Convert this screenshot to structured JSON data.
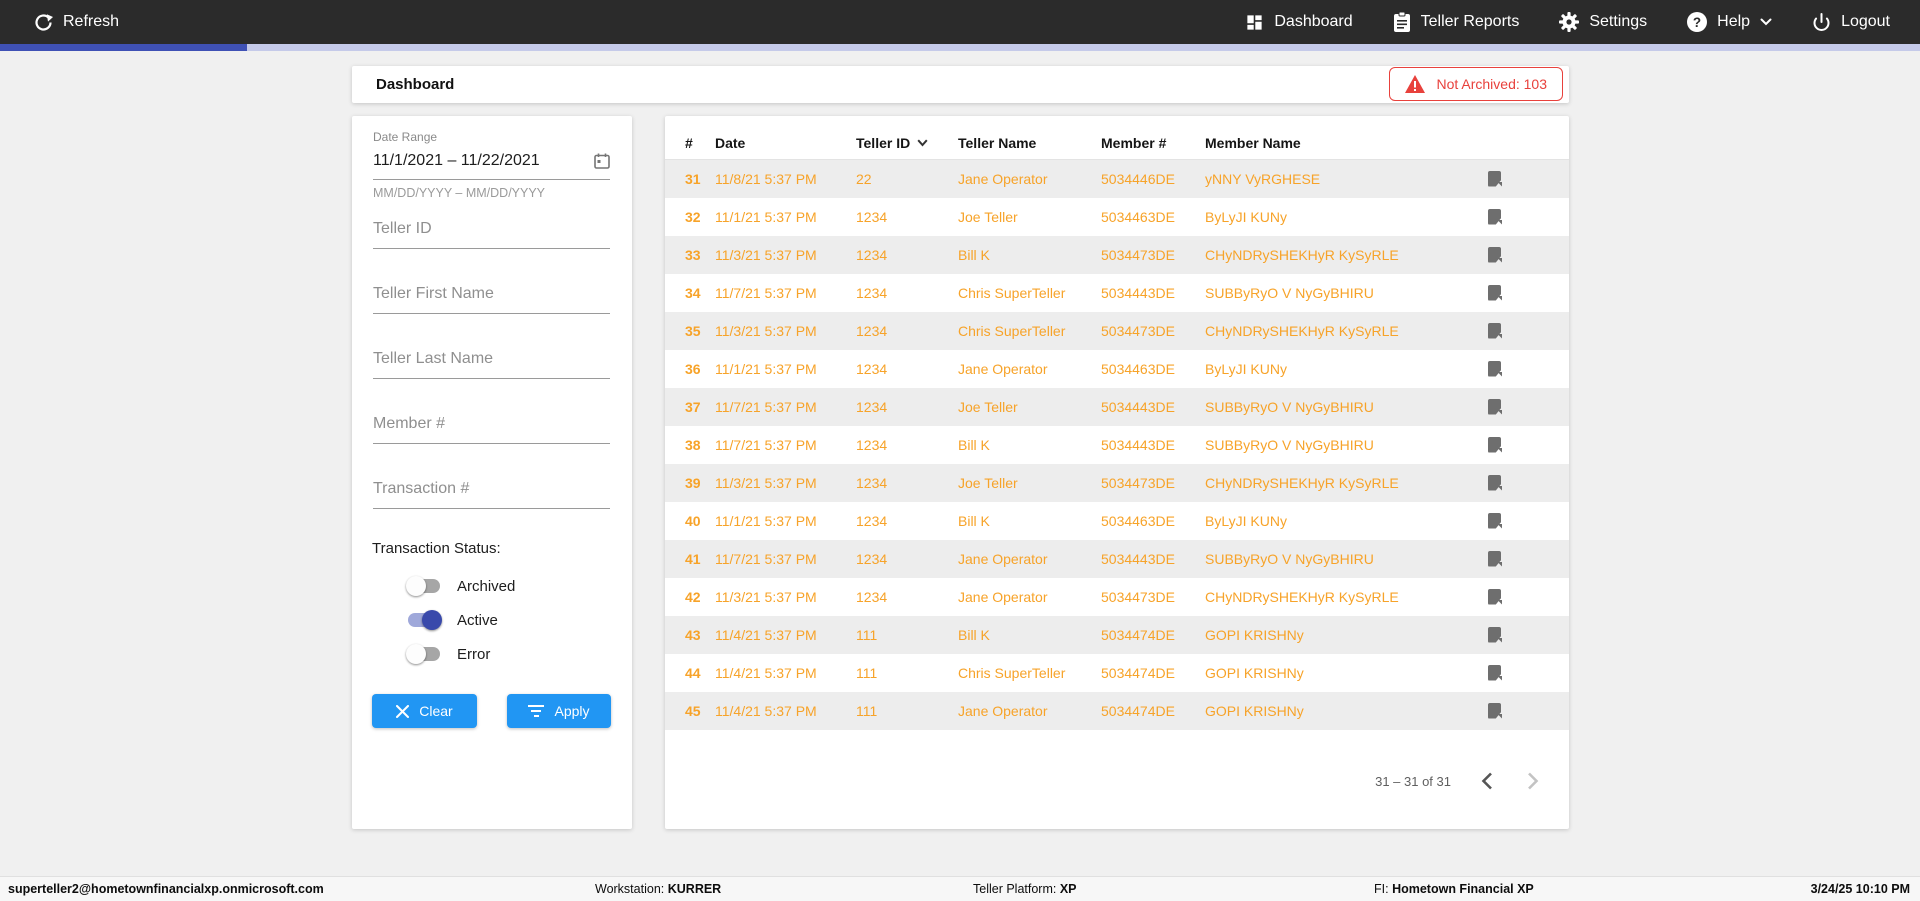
{
  "topnav": {
    "refresh_label": "Refresh",
    "dashboard_label": "Dashboard",
    "teller_reports_label": "Teller Reports",
    "settings_label": "Settings",
    "help_label": "Help",
    "logout_label": "Logout"
  },
  "header": {
    "title": "Dashboard",
    "not_archived_label": "Not Archived: 103"
  },
  "filters": {
    "date_range": {
      "label": "Date Range",
      "value": "11/1/2021 – 11/22/2021",
      "hint": "MM/DD/YYYY – MM/DD/YYYY"
    },
    "fields": [
      {
        "placeholder": "Teller ID"
      },
      {
        "placeholder": "Teller First Name"
      },
      {
        "placeholder": "Teller Last Name"
      },
      {
        "placeholder": "Member #"
      },
      {
        "placeholder": "Transaction #"
      }
    ],
    "status": {
      "label": "Transaction Status:",
      "toggles": [
        {
          "label": "Archived",
          "on": false
        },
        {
          "label": "Active",
          "on": true
        },
        {
          "label": "Error",
          "on": false
        }
      ]
    },
    "clear_label": "Clear",
    "apply_label": "Apply"
  },
  "table": {
    "columns": [
      "#",
      "Date",
      "Teller ID",
      "Teller Name",
      "Member #",
      "Member Name"
    ],
    "sorted_column": "Teller ID",
    "sort_direction": "desc",
    "rows": [
      {
        "num": "31",
        "date": "11/8/21 5:37 PM",
        "teller_id": "22",
        "teller_name": "Jane Operator",
        "member_num": "5034446DE",
        "member_name": "yNNY VyRGHESE"
      },
      {
        "num": "32",
        "date": "11/1/21 5:37 PM",
        "teller_id": "1234",
        "teller_name": "Joe Teller",
        "member_num": "5034463DE",
        "member_name": "ByLyJI KUNy"
      },
      {
        "num": "33",
        "date": "11/3/21 5:37 PM",
        "teller_id": "1234",
        "teller_name": "Bill K",
        "member_num": "5034473DE",
        "member_name": "CHyNDRySHEKHyR KySyRLE"
      },
      {
        "num": "34",
        "date": "11/7/21 5:37 PM",
        "teller_id": "1234",
        "teller_name": "Chris SuperTeller",
        "member_num": "5034443DE",
        "member_name": "SUBByRyO V NyGyBHIRU"
      },
      {
        "num": "35",
        "date": "11/3/21 5:37 PM",
        "teller_id": "1234",
        "teller_name": "Chris SuperTeller",
        "member_num": "5034473DE",
        "member_name": "CHyNDRySHEKHyR KySyRLE"
      },
      {
        "num": "36",
        "date": "11/1/21 5:37 PM",
        "teller_id": "1234",
        "teller_name": "Jane Operator",
        "member_num": "5034463DE",
        "member_name": "ByLyJI KUNy"
      },
      {
        "num": "37",
        "date": "11/7/21 5:37 PM",
        "teller_id": "1234",
        "teller_name": "Joe Teller",
        "member_num": "5034443DE",
        "member_name": "SUBByRyO V NyGyBHIRU"
      },
      {
        "num": "38",
        "date": "11/7/21 5:37 PM",
        "teller_id": "1234",
        "teller_name": "Bill K",
        "member_num": "5034443DE",
        "member_name": "SUBByRyO V NyGyBHIRU"
      },
      {
        "num": "39",
        "date": "11/3/21 5:37 PM",
        "teller_id": "1234",
        "teller_name": "Joe Teller",
        "member_num": "5034473DE",
        "member_name": "CHyNDRySHEKHyR KySyRLE"
      },
      {
        "num": "40",
        "date": "11/1/21 5:37 PM",
        "teller_id": "1234",
        "teller_name": "Bill K",
        "member_num": "5034463DE",
        "member_name": "ByLyJI KUNy"
      },
      {
        "num": "41",
        "date": "11/7/21 5:37 PM",
        "teller_id": "1234",
        "teller_name": "Jane Operator",
        "member_num": "5034443DE",
        "member_name": "SUBByRyO V NyGyBHIRU"
      },
      {
        "num": "42",
        "date": "11/3/21 5:37 PM",
        "teller_id": "1234",
        "teller_name": "Jane Operator",
        "member_num": "5034473DE",
        "member_name": "CHyNDRySHEKHyR KySyRLE"
      },
      {
        "num": "43",
        "date": "11/4/21 5:37 PM",
        "teller_id": "111",
        "teller_name": "Bill K",
        "member_num": "5034474DE",
        "member_name": "GOPI KRISHNy"
      },
      {
        "num": "44",
        "date": "11/4/21 5:37 PM",
        "teller_id": "111",
        "teller_name": "Chris SuperTeller",
        "member_num": "5034474DE",
        "member_name": "GOPI KRISHNy"
      },
      {
        "num": "45",
        "date": "11/4/21 5:37 PM",
        "teller_id": "111",
        "teller_name": "Jane Operator",
        "member_num": "5034474DE",
        "member_name": "GOPI KRISHNy"
      }
    ],
    "pagination": {
      "range_label": "31 – 31 of 31",
      "prev_enabled": true,
      "next_enabled": false
    }
  },
  "statusbar": {
    "user": "superteller2@hometownfinancialxp.onmicrosoft.com",
    "workstation_label": "Workstation:",
    "workstation": "KURRER",
    "platform_label": "Teller Platform:",
    "platform": "XP",
    "fi_label": "FI:",
    "fi": "Hometown Financial XP",
    "datetime": "3/24/25 10:10 PM"
  },
  "icons": {
    "refresh-icon": "circular-arrow",
    "dashboard-icon": "grid-tiles",
    "clipboard-icon": "clipboard",
    "gear-icon": "cog",
    "help-icon": "question-circle",
    "chevron-down-icon": "chevron-down",
    "power-icon": "power",
    "warning-icon": "warning-triangle",
    "calendar-icon": "calendar",
    "clear-x-icon": "cross",
    "filter-icon": "filter-lines",
    "note-icon": "sticky-note",
    "sort-desc-icon": "chevron-down",
    "prev-icon": "chevron-left",
    "next-icon": "chevron-right"
  },
  "colors": {
    "topnav_bg": "#2b2b2b",
    "progress_fill": "#3f51b5",
    "progress_track": "#c5cae9",
    "accent_blue": "#2196f3",
    "row_orange": "#f7a329",
    "alert_red": "#e8413c",
    "toggle_on_knob": "#3949ab",
    "toggle_on_track": "#9fa8da",
    "stripe_gray": "#ededed"
  }
}
